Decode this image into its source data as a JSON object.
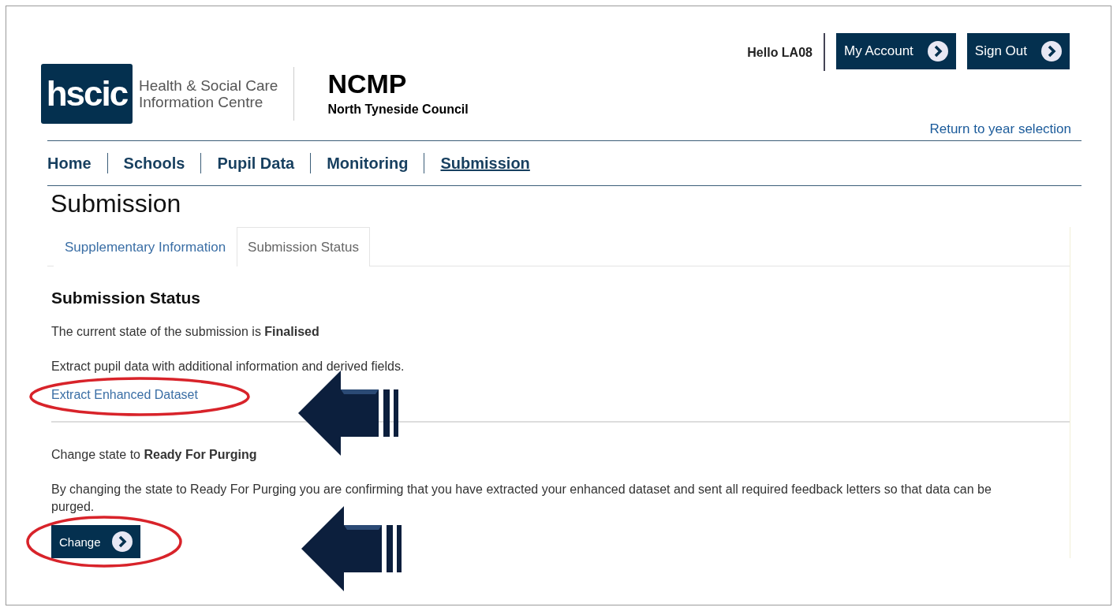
{
  "header": {
    "logo": {
      "mark": "hscic",
      "name_lines": [
        "Health & Social Care",
        "Information Centre"
      ]
    },
    "app_title": "NCMP",
    "organisation": "North Tyneside Council",
    "greeting": "Hello LA08",
    "buttons": [
      "My Account",
      "Sign Out"
    ],
    "return_link": "Return to year selection"
  },
  "nav": [
    {
      "label": "Home",
      "selected": false
    },
    {
      "label": "Schools",
      "selected": false
    },
    {
      "label": "Pupil Data",
      "selected": false
    },
    {
      "label": "Monitoring",
      "selected": false
    },
    {
      "label": "Submission",
      "selected": true
    }
  ],
  "page_heading": "Submission",
  "tabs": [
    {
      "label": "Supplementary Information",
      "selected": false
    },
    {
      "label": "Submission Status",
      "selected": true
    }
  ],
  "section": {
    "heading": "Submission Status",
    "current_state": "The current state of the submission is **Finalised**",
    "extract_text": "Extract pupil data with additional information and derived fields.",
    "extract_link": "Extract Enhanced Dataset",
    "change_heading": "Change state to **Ready For Purging**",
    "change_text": "By changing the state to Ready For Purging you are confirming that you have extracted your enhanced dataset and sent all required feedback letters so that data can be purged.",
    "change_button": "Change"
  }
}
